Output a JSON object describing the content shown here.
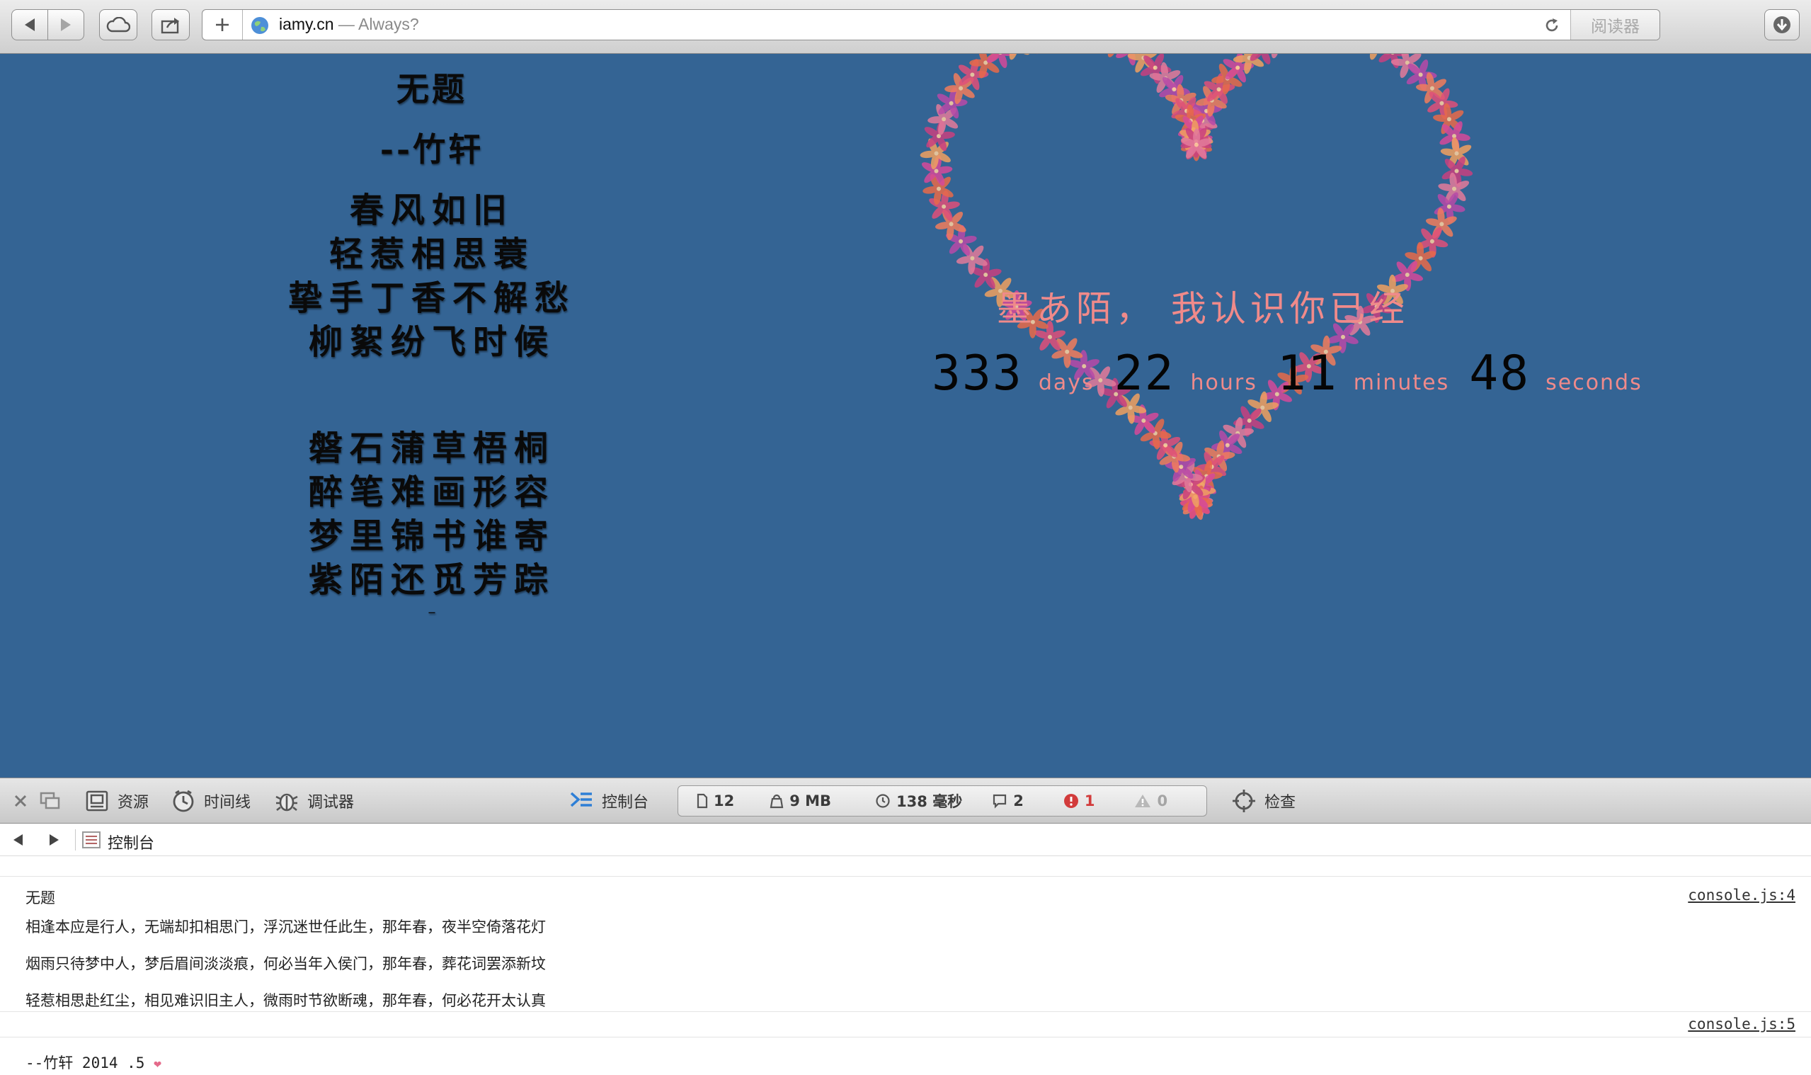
{
  "browser": {
    "url": "iamy.cn",
    "title_suffix": " — Always?",
    "reader_label": "阅读器"
  },
  "poem": {
    "title": "无题",
    "author": "--竹轩",
    "stanza1": [
      "春风如旧",
      "轻惹相思蓑",
      "挚手丁香不解愁",
      "柳絮纷飞时候"
    ],
    "stanza2": [
      "磐石蒲草梧桐",
      "醉笔难画形容",
      "梦里锦书谁寄",
      "紫陌还觅芳踪"
    ],
    "end_mark": "–"
  },
  "love": {
    "message": "墨あ陌， 我认识你已经",
    "days": "333",
    "days_label": "days",
    "hours": "22",
    "hours_label": "hours",
    "minutes": "11",
    "minutes_label": "minutes",
    "seconds": "48",
    "seconds_label": "seconds"
  },
  "inspector": {
    "resources": "资源",
    "timeline": "时间线",
    "debugger": "调试器",
    "console": "控制台",
    "inspect": "检查",
    "metrics": {
      "documents": "12",
      "size": "9 MB",
      "load_time": "138 毫秒",
      "messages": "2",
      "errors": "1",
      "warnings": "0"
    }
  },
  "console": {
    "nav_label": "控制台",
    "group1_title": "无题",
    "group1_source": "console.js:4",
    "lines": [
      "相逢本应是行人，无端却扣相思门，浮沉迷世任此生，那年春，夜半空倚落花灯",
      "烟雨只待梦中人，梦后眉间淡淡痕，何必当年入侯门，那年春，葬花词罢添新坟",
      "轻惹相思赴红尘，相见难识旧主人，微雨时节欲断魂，那年春，何必花开太认真"
    ],
    "group2_source": "console.js:5",
    "signature": "--竹轩 2014 .5 ",
    "heart": "❤"
  },
  "colors": {
    "page_bg": "#346494",
    "love_text": "#f08a8a",
    "counter_digits": "#050505",
    "error_red": "#d23b3b"
  }
}
